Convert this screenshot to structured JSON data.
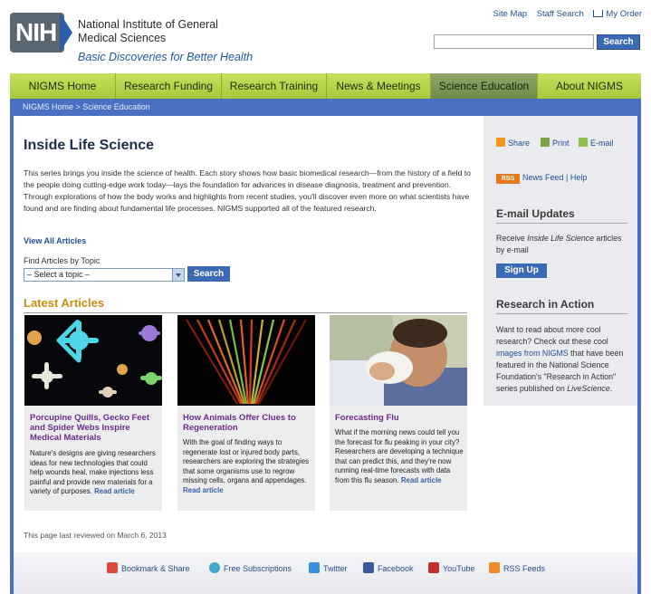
{
  "header": {
    "logo_text": "NIH",
    "org_name": "National Institute of General Medical Sciences",
    "tagline": "Basic Discoveries for Better Health",
    "utility_links": [
      "Site Map",
      "Staff Search",
      "My Order"
    ],
    "search_placeholder": "",
    "search_button": "Search"
  },
  "nav": {
    "items": [
      "NIGMS Home",
      "Research Funding",
      "Research Training",
      "News & Meetings",
      "Science Education",
      "About NIGMS"
    ],
    "active": "Science Education"
  },
  "breadcrumb": "NIGMS Home > Science Education",
  "main": {
    "title": "Inside Life Science",
    "intro": "This series brings you inside the science of health. Each story shows how basic biomedical research—from the history of a field to the people doing cutting-edge work today—lays the foundation for advances in disease diagnosis, treatment and prevention. Through explorations of how the body works and highlights from recent studies, you'll discover even more on what scientists have found and are finding about fundamental life processes. NIGMS supported all of the featured research.",
    "view_all": "View All Articles",
    "find_label": "Find Articles by Topic",
    "topic_select": "– Select a topic –",
    "topic_button": "Search",
    "latest_heading": "Latest Articles",
    "articles": [
      {
        "title": "Porcupine Quills, Gecko Feet and Spider Webs Inspire Medical Materials",
        "desc": "Nature's designs are giving researchers ideas for new technologies that could help wounds heal, make injections less painful and provide new materials for a variety of purposes.",
        "more": "Read article"
      },
      {
        "title": "How Animals Offer Clues to Regeneration",
        "desc": "With the goal of finding ways to regenerate lost or injured body parts, researchers are exploring the strategies that some organisms use to regrow missing cells, organs and appendages.",
        "more": "Read article"
      },
      {
        "title": "Forecasting Flu",
        "desc": "What if the morning news could tell you the forecast for flu peaking in your city? Researchers are developing a technique that can predict this, and they're now running real-time forecasts with data from this flu season.",
        "more": "Read article"
      }
    ],
    "reviewed": "This page last reviewed on March 6, 2013"
  },
  "sidebar": {
    "share_links": [
      "Share",
      "Print",
      "E-mail"
    ],
    "rss_badge": "RSS",
    "rss_text": "News Feed | Help",
    "email_heading": "E-mail Updates",
    "email_text_pre": "Receive ",
    "email_text_em": "Inside Life Science",
    "email_text_post": " articles by e-mail",
    "signup_button": "Sign Up",
    "ria_heading": "Research in Action",
    "ria_text_1": "Want to read about more cool research? Check out these cool ",
    "ria_link": "images from NIGMS",
    "ria_text_2": " that have been featured in the National Science Foundation's \"Research in Action\" series published on ",
    "ria_em": "LiveScience",
    "ria_text_3": "."
  },
  "footer": {
    "links": [
      "Bookmark & Share",
      "Free Subscriptions",
      "Twitter",
      "Facebook",
      "YouTube",
      "RSS Feeds"
    ]
  },
  "colors": {
    "nav_green": "#b5d44a",
    "frame_blue": "#4a70c4",
    "accent_orange": "#c88d12",
    "article_title_purple": "#6d2c8d"
  }
}
